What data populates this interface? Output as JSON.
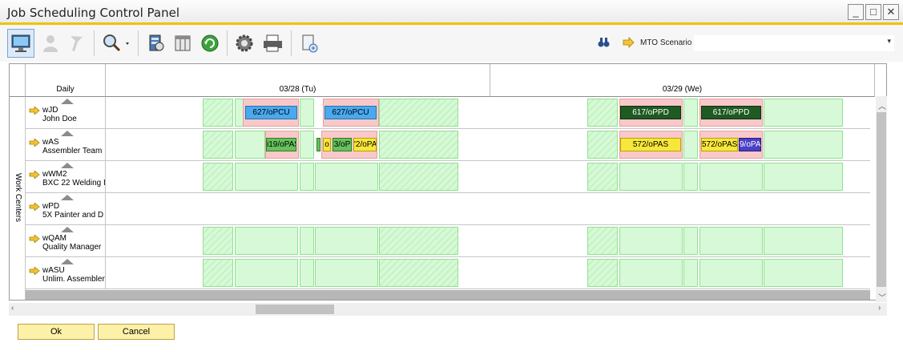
{
  "window": {
    "title": "Job Scheduling Control Panel",
    "minimize": "_",
    "maximize": "□",
    "close": "✕"
  },
  "toolbar": {
    "icons": [
      "monitor-icon",
      "user-icon",
      "tools-icon",
      "search-icon",
      "database-search-icon",
      "columns-icon",
      "refresh-icon",
      "settings-icon",
      "printer-icon",
      "export-icon"
    ]
  },
  "scenario": {
    "label": "MTO Scenario",
    "arrow": "▾"
  },
  "gantt": {
    "period": "Daily",
    "dates": [
      "03/28 (Tu)",
      "03/29 (We)"
    ],
    "side_label": "Work Centers",
    "rows": [
      {
        "code": "wJD",
        "name": "John Doe",
        "jobs": [
          "627/oPCU",
          "627/oPCU",
          "617/oPPD",
          "617/oPPD"
        ]
      },
      {
        "code": "wAS",
        "name": "Assembler Team",
        "jobs": [
          "i19/oPAS",
          "o",
          "3/oP",
          "'2/oPA",
          "572/oPAS",
          "572/oPAS",
          "9/oPA"
        ]
      },
      {
        "code": "wWM2",
        "name": "BXC 22 Welding I",
        "jobs": []
      },
      {
        "code": "wPD",
        "name": "5X Painter and D",
        "jobs": []
      },
      {
        "code": "wQAM",
        "name": "Quality Manager",
        "jobs": []
      },
      {
        "code": "wASU",
        "name": "Unlim. Assembler",
        "jobs": []
      }
    ]
  },
  "buttons": {
    "ok": "Ok",
    "cancel": "Cancel"
  },
  "colors": {
    "accent": "#f0c200",
    "free_time": "#d7f9d7",
    "conflict": "#f9c9c9"
  }
}
